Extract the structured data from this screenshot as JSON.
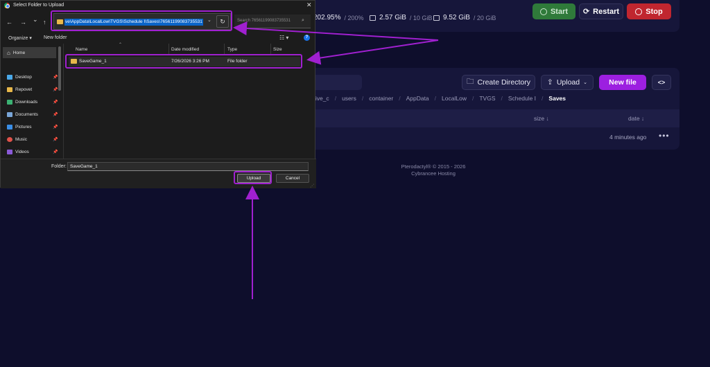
{
  "panel": {
    "stats": [
      {
        "value": "202.95%",
        "limit": "/ 200%"
      },
      {
        "value": "2.57 GiB",
        "limit": "/ 10 GiB"
      },
      {
        "value": "9.52 GiB",
        "limit": "/ 20 GiB"
      }
    ],
    "power": {
      "start": "Start",
      "restart": "Restart",
      "stop": "Stop"
    },
    "colors": {
      "accent": "#9c1fe0",
      "start": "#2f7a3a",
      "stop": "#c0262f",
      "background": "#0e0e2c",
      "card": "#16163a"
    },
    "files": {
      "create_directory": "Create Directory",
      "upload": "Upload",
      "new_file": "New file",
      "code_icon": "<>",
      "breadcrumbs": [
        "rive_c",
        "users",
        "container",
        "AppData",
        "LocalLow",
        "TVGS",
        "Schedule I"
      ],
      "current_folder": "Saves",
      "columns": {
        "size": "size ↓",
        "date": "date ↓"
      },
      "row": {
        "date": "4 minutes ago",
        "menu": "•••"
      }
    },
    "footer": {
      "line1": "Pterodactyl® © 2015 - 2026",
      "line2": "Cybrancee Hosting"
    }
  },
  "dialog": {
    "title": "Select Folder to Upload",
    "close": "✕",
    "nav": {
      "back": "←",
      "forward": "→",
      "recent": "⌄",
      "up": "↑"
    },
    "address": "ve\\AppData\\LocalLow\\TVGS\\Schedule I\\Saves\\76561199083735531",
    "search_placeholder": "Search 76561199083735531",
    "toolbar": {
      "organize": "Organize",
      "new_folder": "New folder"
    },
    "sidebar": {
      "home": "Home",
      "items": [
        {
          "label": "Desktop",
          "icon": "desktop-icon",
          "color": "#4aa8e8"
        },
        {
          "label": "Repovet",
          "icon": "folder-icon",
          "color": "#e8b84a"
        },
        {
          "label": "Downloads",
          "icon": "download-icon",
          "color": "#3bb273"
        },
        {
          "label": "Documents",
          "icon": "documents-icon",
          "color": "#7aa6d8"
        },
        {
          "label": "Pictures",
          "icon": "pictures-icon",
          "color": "#3a8ee6"
        },
        {
          "label": "Music",
          "icon": "music-icon",
          "color": "#e0524a"
        },
        {
          "label": "Videos",
          "icon": "videos-icon",
          "color": "#8a5ad8"
        }
      ]
    },
    "columns": {
      "name": "Name",
      "date": "Date modified",
      "type": "Type",
      "size": "Size"
    },
    "rows": [
      {
        "name": "SaveGame_1",
        "date": "7/26/2026 3:26 PM",
        "type": "File folder",
        "size": ""
      }
    ],
    "folder_label": "Folder:",
    "folder_value": "SaveGame_1",
    "upload": "Upload",
    "cancel": "Cancel"
  }
}
